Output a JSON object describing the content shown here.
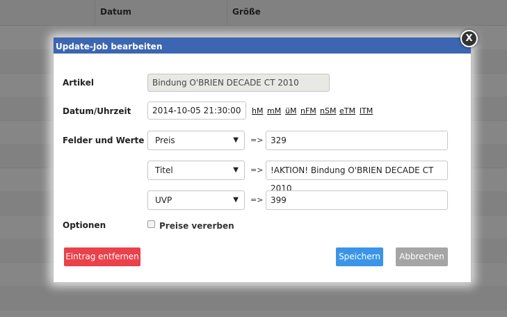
{
  "table": {
    "columns": [
      "Datum",
      "Größe"
    ]
  },
  "dialog": {
    "title": "Update-Job bearbeiten",
    "close_label": "X",
    "artikel": {
      "label": "Artikel",
      "value": "Bindung O'BRIEN DECADE CT 2010"
    },
    "datum": {
      "label": "Datum/Uhrzeit",
      "value": "2014-10-05 21:30:00",
      "shortcuts": [
        "hM",
        "mM",
        "üM",
        "nFM",
        "nSM",
        "eTM",
        "lTM"
      ]
    },
    "felder": {
      "label": "Felder und Werte",
      "arrow": "=>",
      "rows": [
        {
          "field": "Preis",
          "value": "329"
        },
        {
          "field": "Titel",
          "value": "!AKTION! Bindung O'BRIEN DECADE CT 2010"
        },
        {
          "field": "UVP",
          "value": "399"
        }
      ]
    },
    "optionen": {
      "label": "Optionen",
      "checkbox_label": "Preise vererben",
      "checked": false
    },
    "buttons": {
      "remove": "Eintrag entfernen",
      "save": "Speichern",
      "cancel": "Abbrechen"
    },
    "colors": {
      "title_bar": "#3c66b1",
      "danger": "#ec414b",
      "primary": "#3a95e8",
      "neutral": "#a5a5a5"
    }
  }
}
